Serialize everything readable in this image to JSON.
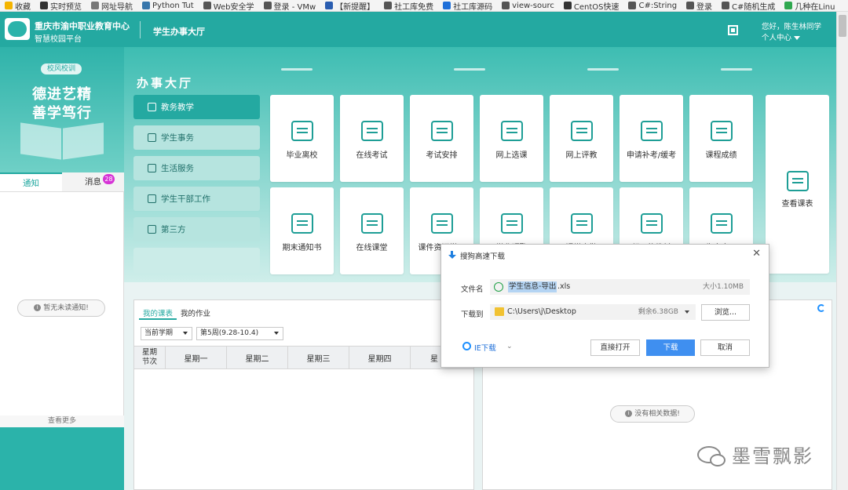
{
  "bookmarks": [
    {
      "label": "收藏",
      "color": "#f4b400"
    },
    {
      "label": "实时预览",
      "color": "#333333"
    },
    {
      "label": "网址导航",
      "color": "#777777"
    },
    {
      "label": "Python Tut",
      "color": "#3776ab"
    },
    {
      "label": "Web安全学",
      "color": "#555555"
    },
    {
      "label": "登录 - VMw",
      "color": "#555555"
    },
    {
      "label": "【新提醒】",
      "color": "#2a5db0"
    },
    {
      "label": "社工库免费",
      "color": "#555555"
    },
    {
      "label": "社工库源码",
      "color": "#1e6fd9"
    },
    {
      "label": "view-sourc",
      "color": "#555555"
    },
    {
      "label": "CentOS快速",
      "color": "#333333"
    },
    {
      "label": "C#:String",
      "color": "#555555"
    },
    {
      "label": "登录",
      "color": "#555555"
    },
    {
      "label": "C#随机生成",
      "color": "#555555"
    },
    {
      "label": "几种在Linu",
      "color": "#2fa84f"
    }
  ],
  "header": {
    "org_name": "重庆市渝中职业教育中心",
    "org_sub": "智慧校园平台",
    "hall_title": "学生办事大厅",
    "greeting": "您好，陈生林同学",
    "personal_center": "个人中心"
  },
  "left": {
    "motto_tag": "校风校训",
    "motto_line1": "德进艺精",
    "motto_line2": "善学笃行",
    "tab_notice": "通知",
    "tab_message": "消息",
    "message_count": "28",
    "no_notice": "暂无未读通知!",
    "see_more": "查看更多"
  },
  "hall": {
    "heading": "办事大厅",
    "categories": [
      {
        "label": "教务教学"
      },
      {
        "label": "学生事务"
      },
      {
        "label": "生活服务"
      },
      {
        "label": "学生干部工作"
      },
      {
        "label": "第三方"
      }
    ],
    "tiles_row1": [
      {
        "label": "毕业离校",
        "icon": "graduation-cap-icon"
      },
      {
        "label": "在线考试",
        "icon": "exam-icon"
      },
      {
        "label": "考试安排",
        "icon": "schedule-doc-icon"
      },
      {
        "label": "网上选课",
        "icon": "course-select-icon"
      },
      {
        "label": "网上评教",
        "icon": "evaluate-icon"
      },
      {
        "label": "申请补考/缓考",
        "icon": "apply-exam-icon"
      },
      {
        "label": "课程成绩",
        "icon": "score-icon"
      }
    ],
    "tiles_row2": [
      {
        "label": "期末通知书",
        "icon": "notice-card-icon"
      },
      {
        "label": "在线课堂",
        "icon": "lamp-icon"
      },
      {
        "label": "课件资源学习",
        "icon": "stack-icon"
      },
      {
        "label": "学业预警",
        "icon": "warning-shield-icon"
      },
      {
        "label": "课堂出勤",
        "icon": "attendance-icon"
      },
      {
        "label": "领用的教材",
        "icon": "textbook-icon"
      },
      {
        "label": "生产实习",
        "icon": "thermometer-icon"
      }
    ],
    "big_tile": {
      "label": "查看课表",
      "icon": "timetable-icon"
    }
  },
  "schedule": {
    "tab_my_courses": "我的课表",
    "tab_my_homework": "我的作业",
    "term_select": "当前学期",
    "week_select": "第5周(9.28-10.4)",
    "corner_top": "星期",
    "corner_bottom": "节次",
    "days": [
      "星期一",
      "星期二",
      "星期三",
      "星期四",
      "星"
    ]
  },
  "right_panel": {
    "no_data": "没有相关数据!"
  },
  "dialog": {
    "title": "搜狗高速下载",
    "file_label": "文件名",
    "file_name_selected": "学生信息-导出",
    "file_ext": ".xls",
    "size": "大小1.10MB",
    "save_label": "下载到",
    "path": "C:\\Users\\j\\Desktop",
    "free_space": "剩余6.38GB",
    "browse": "浏览...",
    "ie_download": "IE下载",
    "open_directly": "直接打开",
    "download": "下载",
    "cancel": "取消"
  },
  "watermark": {
    "text": "墨雪飘影"
  },
  "colors": {
    "brand_teal": "#24a9a1",
    "primary_blue": "#3f8ff0",
    "badge_magenta": "#d633d6"
  }
}
